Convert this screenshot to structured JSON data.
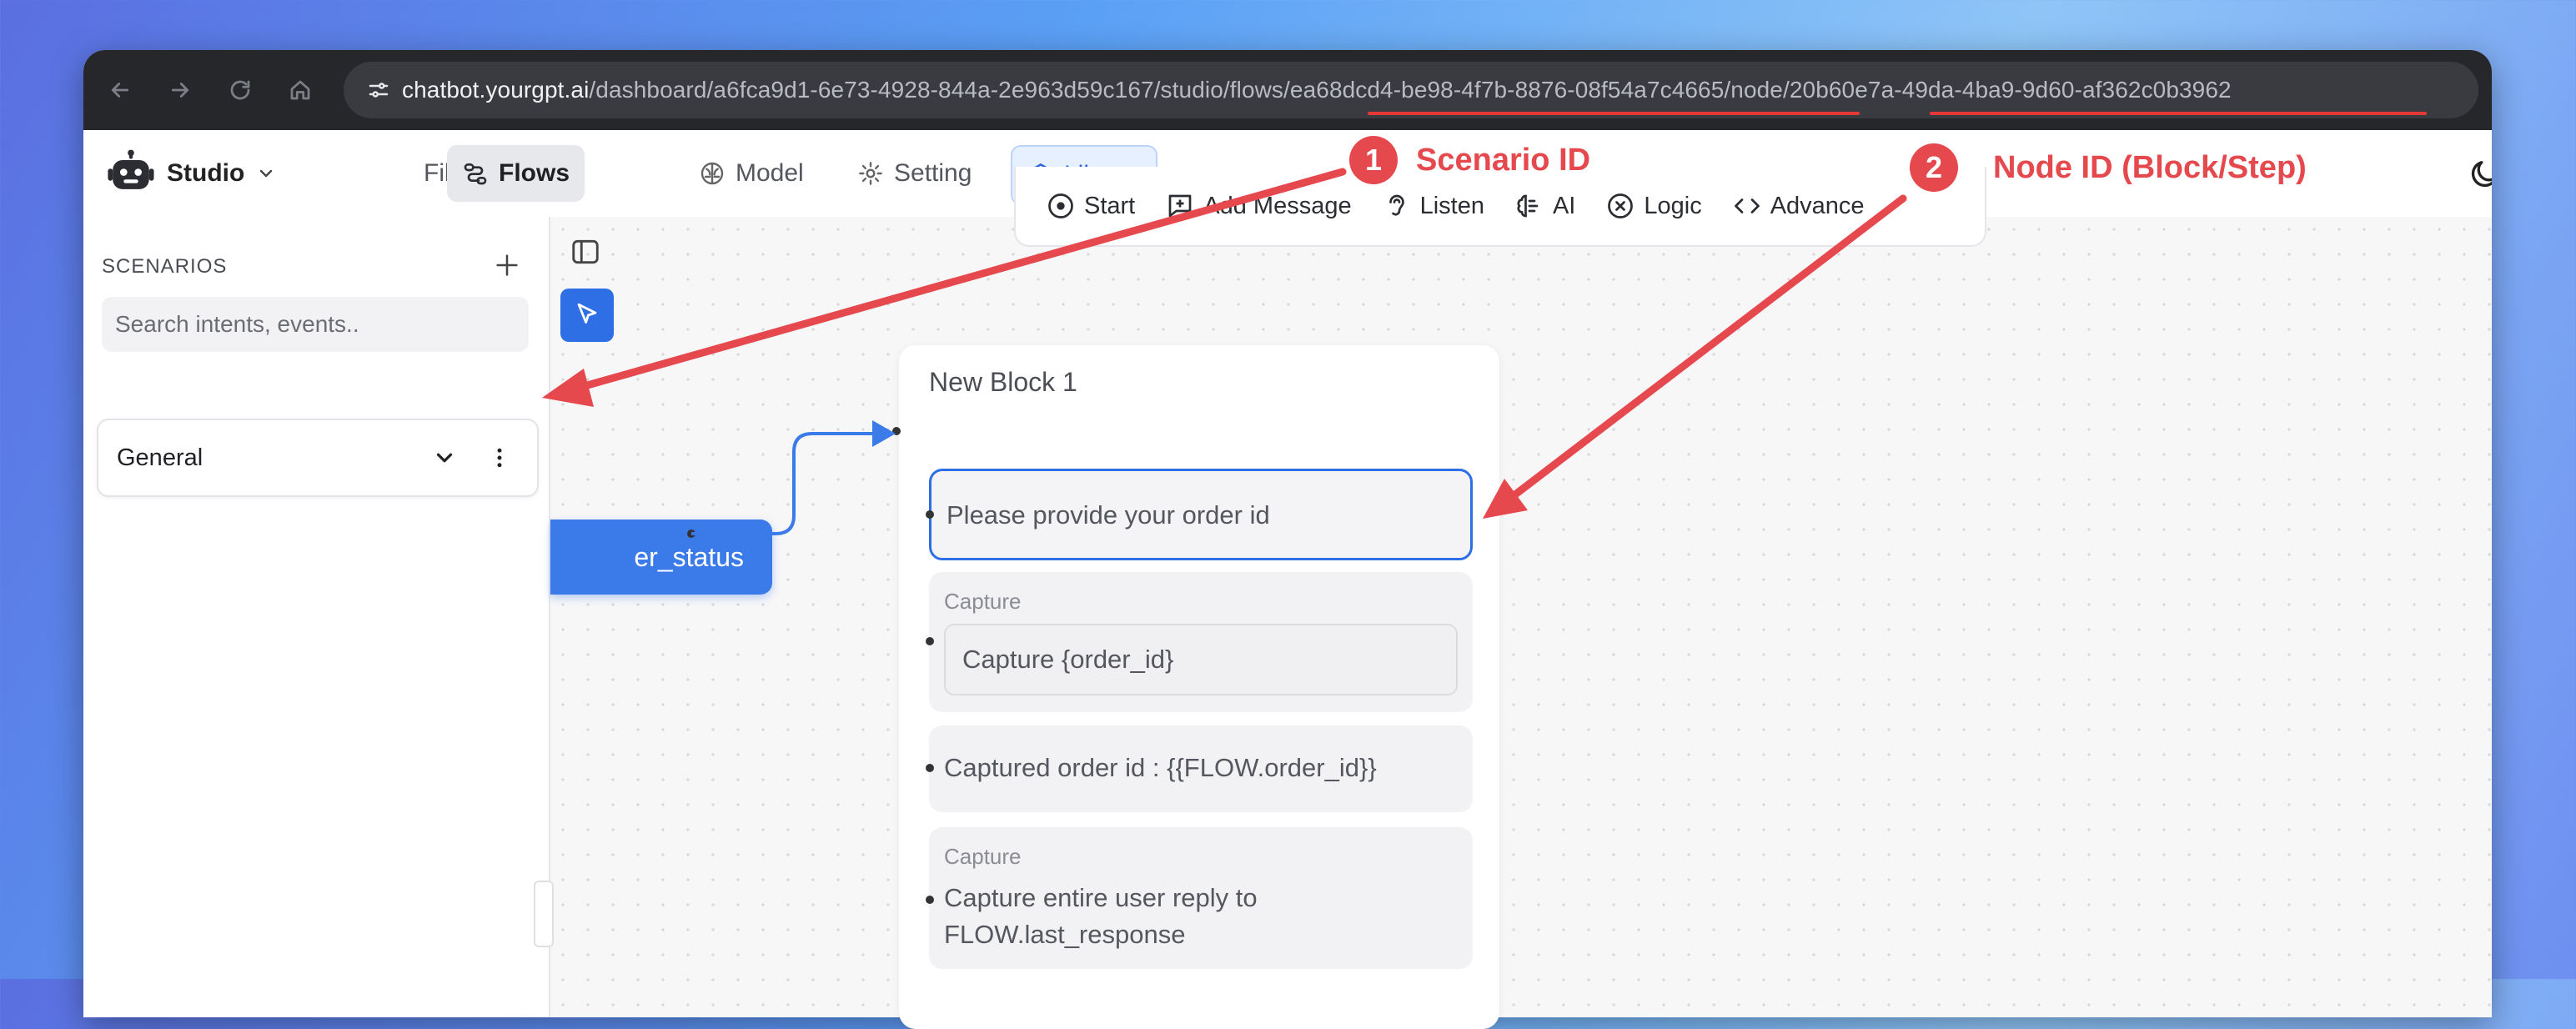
{
  "browser": {
    "url_host": "chatbot.yourgpt.ai",
    "url_path_1": "/dashboard/a6fca9d1-6e73-4928-844a-2e963d59c167/studio/flows/",
    "scenario_id": "ea68dcd4-be98-4f7b-8876-08f54a7c4665",
    "url_path_2": "/node/",
    "node_id": "20b60e7a-49da-4ba9-9d60-af362c0b3962",
    "icons": [
      "back-arrow-icon",
      "forward-arrow-icon",
      "reload-icon",
      "home-icon",
      "site-settings-icon"
    ]
  },
  "header": {
    "brand": "Studio",
    "menu": {
      "file": "File",
      "flows": "Flows",
      "model": "Model",
      "setting": "Setting",
      "library": "Library"
    }
  },
  "sidebar": {
    "title": "SCENARIOS",
    "search_placeholder": "Search intents, events..",
    "scenarios": [
      {
        "label": "General"
      }
    ]
  },
  "toolbar": {
    "start": "Start",
    "add_message": "Add Message",
    "listen": "Listen",
    "ai": "AI",
    "logic": "Logic",
    "advance": "Advance"
  },
  "canvas": {
    "trigger_label": "er_status",
    "block": {
      "title": "New Block 1",
      "steps": [
        {
          "text": "Please provide your order id"
        },
        {
          "label": "Capture",
          "text": "Capture {order_id}"
        },
        {
          "text": "Captured order id : {{FLOW.order_id}}"
        },
        {
          "label": "Capture",
          "text_line1": "Capture entire user reply to",
          "text_line2": "FLOW.last_response"
        }
      ]
    }
  },
  "annotations": [
    {
      "number": "1",
      "label": "Scenario ID"
    },
    {
      "number": "2",
      "label": "Node ID (Block/Step)"
    }
  ],
  "colors": {
    "annotation_red": "#e5484d",
    "accent_blue": "#2f6fe6",
    "trigger_blue": "#3b7be9"
  }
}
